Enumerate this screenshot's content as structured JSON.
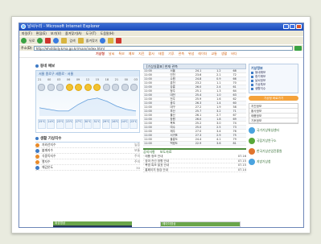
{
  "window": {
    "title": "날씨누리 - Microsoft Internet Explorer",
    "menu": [
      "파일(F)",
      "편집(E)",
      "보기(V)",
      "즐겨찾기(A)",
      "도구(T)",
      "도움말(H)"
    ],
    "toolbar": [
      "뒤로",
      "검색",
      "즐겨찾기"
    ],
    "address_label": "주소(D)",
    "address_value": "http://ehstdaily.kma.go.kr/main/index.html"
  },
  "site": {
    "brand": "기상청",
    "nav": [
      "날씨",
      "특보",
      "예보",
      "지진",
      "황사",
      "태풍",
      "기후",
      "관측",
      "위성",
      "레이더",
      "교통",
      "생활",
      "바다"
    ]
  },
  "forecast": {
    "title": "동네 예보",
    "head": "서울 종로구 세종로 · 서울",
    "hours": [
      "21",
      "00",
      "03",
      "06",
      "09",
      "12",
      "15",
      "18",
      "21",
      "00",
      "03"
    ],
    "temps": [
      "25℃",
      "24℃",
      "23℃",
      "23℃",
      "27℃",
      "30℃",
      "31℃",
      "29℃",
      "26℃",
      "24℃",
      "23℃"
    ]
  },
  "warnings": {
    "title": "생활 기상지수",
    "items": [
      {
        "label": "자외선지수",
        "value": "높음"
      },
      {
        "label": "불쾌지수",
        "value": "보통"
      },
      {
        "label": "식중독지수",
        "value": "주의"
      },
      {
        "label": "열지수",
        "value": "주의"
      },
      {
        "label": "체감온도",
        "value": "30"
      }
    ]
  },
  "obs_table": {
    "title": "[기상실황표] 현재 관측",
    "rows": [
      [
        "11:00",
        "서울",
        "24.1",
        "1.2",
        "68"
      ],
      [
        "11:00",
        "인천",
        "23.6",
        "2.1",
        "72"
      ],
      [
        "11:00",
        "수원",
        "24.8",
        "0.9",
        "66"
      ],
      [
        "11:00",
        "춘천",
        "23.2",
        "1.1",
        "70"
      ],
      [
        "11:00",
        "강릉",
        "26.0",
        "2.4",
        "61"
      ],
      [
        "11:00",
        "청주",
        "25.1",
        "1.3",
        "64"
      ],
      [
        "11:00",
        "대전",
        "25.4",
        "1.0",
        "63"
      ],
      [
        "11:00",
        "전주",
        "25.9",
        "1.6",
        "62"
      ],
      [
        "11:00",
        "광주",
        "26.3",
        "1.4",
        "60"
      ],
      [
        "11:00",
        "대구",
        "27.2",
        "1.9",
        "58"
      ],
      [
        "11:00",
        "부산",
        "25.7",
        "3.2",
        "71"
      ],
      [
        "11:00",
        "울산",
        "26.1",
        "2.7",
        "67"
      ],
      [
        "11:00",
        "창원",
        "26.0",
        "1.8",
        "69"
      ],
      [
        "11:00",
        "목포",
        "25.2",
        "3.0",
        "74"
      ],
      [
        "11:00",
        "여수",
        "25.0",
        "2.5",
        "73"
      ],
      [
        "11:00",
        "제주",
        "27.0",
        "3.4",
        "76"
      ],
      [
        "11:00",
        "서귀포",
        "27.3",
        "2.9",
        "75"
      ],
      [
        "11:00",
        "울릉도",
        "24.4",
        "4.1",
        "79"
      ],
      [
        "11:00",
        "백령도",
        "22.9",
        "3.6",
        "81"
      ]
    ]
  },
  "notices": {
    "tabs": [
      "공지사항",
      "보도자료"
    ],
    "items": [
      {
        "text": "· 태풍 정보 안내",
        "date": "07.16"
      },
      {
        "text": "· 장마 전선 영향 안내",
        "date": "07.15"
      },
      {
        "text": "· 폭염 특보 발표 안내",
        "date": "07.15"
      },
      {
        "text": "· 홈페이지 점검 안내",
        "date": "07.14"
      }
    ]
  },
  "sidebar": {
    "title": "기상정보",
    "links": [
      "동네예보",
      "중기예보",
      "날씨정보",
      "기상특보",
      "생활지수"
    ],
    "orange_button": "기상청 바로가기",
    "list": [
      "지진정보",
      "황사정보",
      "태풍정보",
      "기후정보"
    ],
    "logos": [
      "국가기상위성센터",
      "국립기상연구소",
      "한국기상산업진흥원",
      "지방기상청"
    ]
  },
  "bottom": {
    "satellite_title": "위성영상",
    "radar_title": "레이더영상"
  },
  "colors": {
    "title_bar": "#1a4ab9",
    "accent_blue": "#3e7bc6",
    "accent_green": "#6aa54a",
    "accent_orange": "#f4a23b"
  }
}
